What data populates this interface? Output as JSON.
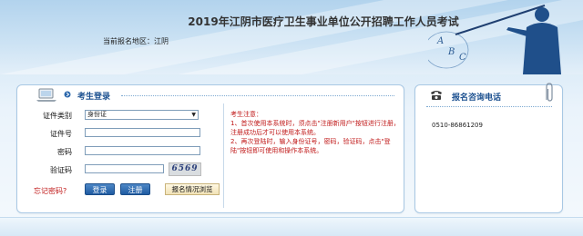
{
  "header": {
    "title": "2019年江阴市医疗卫生事业单位公开招聘工作人员考试",
    "region_label": "当前报名地区：",
    "region_value": "江阴",
    "figure_letters": [
      "A",
      "B",
      "C"
    ]
  },
  "login": {
    "title": "考生登录",
    "id_type_label": "证件类别",
    "id_type_value": "身份证",
    "id_number_label": "证件号",
    "password_label": "密码",
    "captcha_label": "验证码",
    "captcha_code": "6569",
    "forgot_link": "忘记密码?",
    "login_button": "登录",
    "register_button": "注册",
    "status_button": "报名情况浏览"
  },
  "notice": {
    "title": "考生注意：",
    "line1": "1、首次使用本系统时，须点击\"注册新用户\"按钮进行注册，注册成功后才可以使用本系统。",
    "line2": "2、再次登陆时，输入身份证号，密码，验证码，点击\"登陆\"按钮即可使用和操作本系统。"
  },
  "contact": {
    "title": "报名咨询电话",
    "phone": "0510-86861209"
  },
  "colors": {
    "accent": "#1a4f8f",
    "warning": "#c01818",
    "button": "#2a66ab"
  }
}
